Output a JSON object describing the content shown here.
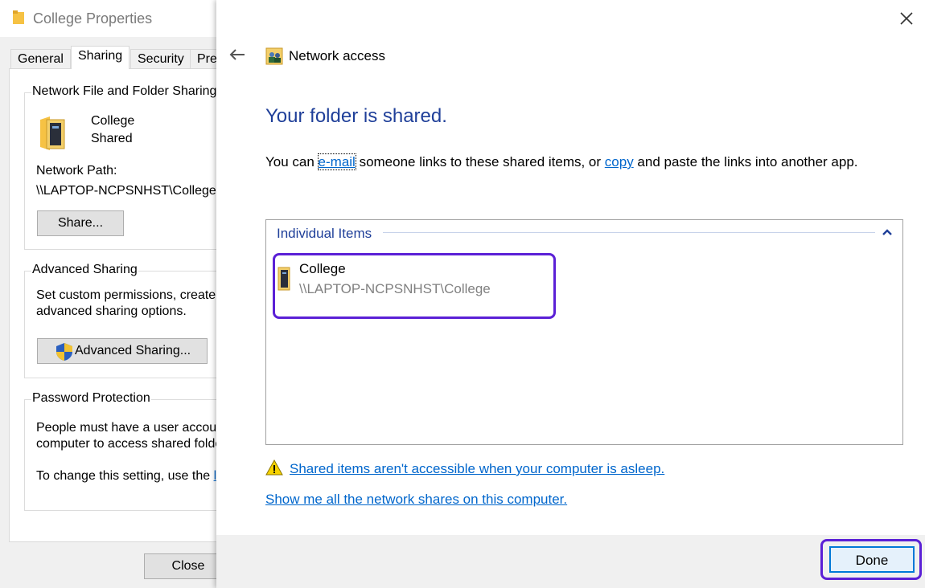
{
  "props_window": {
    "title": "College Properties",
    "tabs": [
      "General",
      "Sharing",
      "Security",
      "Pre"
    ],
    "network_sharing": {
      "group_label": "Network File and Folder Sharing",
      "folder_name": "College",
      "folder_status": "Shared",
      "path_label": "Network Path:",
      "path_value": "\\\\LAPTOP-NCPSNHST\\College",
      "share_button": "Share..."
    },
    "advanced": {
      "group_label": "Advanced Sharing",
      "line1": "Set custom permissions, create",
      "line2": "advanced sharing options.",
      "button": "Advanced Sharing..."
    },
    "password": {
      "group_label": "Password Protection",
      "line1": "People must have a user accour",
      "line2": "computer to access shared folde",
      "line3_prefix": "To change this setting, use the",
      "line3_link": "l"
    },
    "close_button": "Close"
  },
  "panel": {
    "heading": "Network access",
    "success_title": "Your folder is shared.",
    "desc": {
      "before": "You can ",
      "email_link": "e-mail",
      "middle": " someone links to these shared items, or ",
      "copy_link": "copy",
      "after": " and paste the links into another app."
    },
    "items_group_label": "Individual Items",
    "items": [
      {
        "name": "College",
        "path": "\\\\LAPTOP-NCPSNHST\\College"
      }
    ],
    "warning_link": "Shared items aren't accessible when your computer is asleep.",
    "show_shares_link": "Show me all the network shares on this computer.",
    "done_button": "Done"
  },
  "colors": {
    "title_blue": "#1f3f99",
    "link_blue": "#0066cc",
    "highlight": "#5b20d6"
  }
}
